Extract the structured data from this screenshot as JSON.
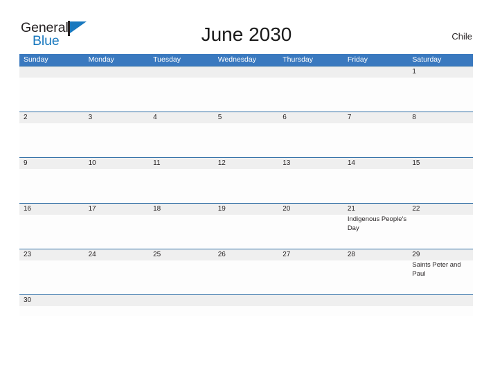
{
  "brand": {
    "word_one": "General",
    "word_two": "Blue",
    "flag_icon": "flag-triangle-icon",
    "accent_color": "#1878be"
  },
  "header": {
    "title": "June 2030",
    "country": "Chile"
  },
  "colors": {
    "header_blue": "#3a79bf",
    "row_rule_blue": "#2e6da4",
    "date_band_gray": "#efefef",
    "text": "#231f20"
  },
  "calendar": {
    "month": "June",
    "year": "2030",
    "weekday_headers": [
      "Sunday",
      "Monday",
      "Tuesday",
      "Wednesday",
      "Thursday",
      "Friday",
      "Saturday"
    ],
    "weeks": [
      {
        "days": [
          {
            "date": "",
            "event": ""
          },
          {
            "date": "",
            "event": ""
          },
          {
            "date": "",
            "event": ""
          },
          {
            "date": "",
            "event": ""
          },
          {
            "date": "",
            "event": ""
          },
          {
            "date": "",
            "event": ""
          },
          {
            "date": "1",
            "event": ""
          }
        ]
      },
      {
        "days": [
          {
            "date": "2",
            "event": ""
          },
          {
            "date": "3",
            "event": ""
          },
          {
            "date": "4",
            "event": ""
          },
          {
            "date": "5",
            "event": ""
          },
          {
            "date": "6",
            "event": ""
          },
          {
            "date": "7",
            "event": ""
          },
          {
            "date": "8",
            "event": ""
          }
        ]
      },
      {
        "days": [
          {
            "date": "9",
            "event": ""
          },
          {
            "date": "10",
            "event": ""
          },
          {
            "date": "11",
            "event": ""
          },
          {
            "date": "12",
            "event": ""
          },
          {
            "date": "13",
            "event": ""
          },
          {
            "date": "14",
            "event": ""
          },
          {
            "date": "15",
            "event": ""
          }
        ]
      },
      {
        "days": [
          {
            "date": "16",
            "event": ""
          },
          {
            "date": "17",
            "event": ""
          },
          {
            "date": "18",
            "event": ""
          },
          {
            "date": "19",
            "event": ""
          },
          {
            "date": "20",
            "event": ""
          },
          {
            "date": "21",
            "event": "Indigenous People's Day"
          },
          {
            "date": "22",
            "event": ""
          }
        ]
      },
      {
        "days": [
          {
            "date": "23",
            "event": ""
          },
          {
            "date": "24",
            "event": ""
          },
          {
            "date": "25",
            "event": ""
          },
          {
            "date": "26",
            "event": ""
          },
          {
            "date": "27",
            "event": ""
          },
          {
            "date": "28",
            "event": ""
          },
          {
            "date": "29",
            "event": "Saints Peter and Paul"
          }
        ]
      },
      {
        "days": [
          {
            "date": "30",
            "event": ""
          },
          {
            "date": "",
            "event": ""
          },
          {
            "date": "",
            "event": ""
          },
          {
            "date": "",
            "event": ""
          },
          {
            "date": "",
            "event": ""
          },
          {
            "date": "",
            "event": ""
          },
          {
            "date": "",
            "event": ""
          }
        ]
      }
    ]
  }
}
